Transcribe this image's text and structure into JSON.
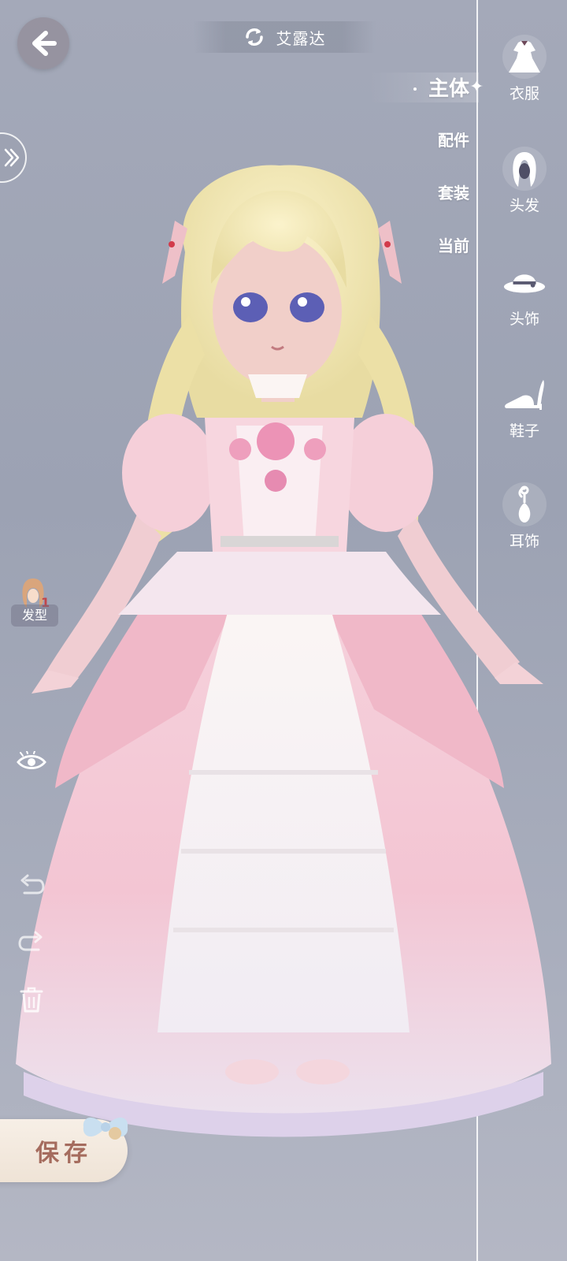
{
  "header": {
    "character_name": "艾露达",
    "back_icon": "back-arrow-icon",
    "switch_icon": "refresh-icon"
  },
  "categories": [
    {
      "label": "主体",
      "active": true
    },
    {
      "label": "配件",
      "active": false
    },
    {
      "label": "套装",
      "active": false
    },
    {
      "label": "当前",
      "active": false
    }
  ],
  "slots": [
    {
      "label": "衣服",
      "icon": "dress-icon"
    },
    {
      "label": "头发",
      "icon": "hair-icon"
    },
    {
      "label": "头饰",
      "icon": "hat-icon"
    },
    {
      "label": "鞋子",
      "icon": "shoe-icon"
    },
    {
      "label": "耳饰",
      "icon": "earring-icon"
    }
  ],
  "left_tools": {
    "hairstyle_label": "发型",
    "hairstyle_badge": "1",
    "visibility_icon": "eye-icon",
    "undo_icon": "undo-icon",
    "redo_icon": "redo-icon",
    "delete_icon": "trash-icon",
    "expand_icon": "double-chevron-right-icon"
  },
  "footer": {
    "save_label": "保存"
  },
  "colors": {
    "background": "#a4a9b9",
    "accent_text": "#ffffff",
    "save_text": "#a56c5e",
    "save_bg": "#f3e9df",
    "dress_pink": "#f2c6d2"
  }
}
